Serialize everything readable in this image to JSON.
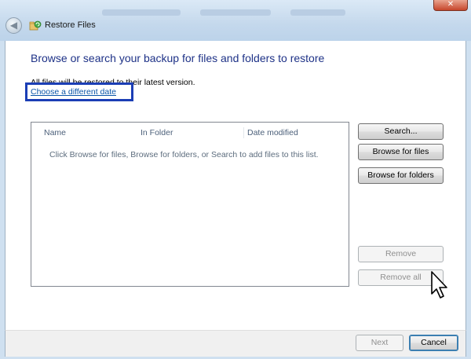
{
  "window": {
    "title": "Restore Files",
    "close_label": "✕",
    "back_label": "◀"
  },
  "page": {
    "heading": "Browse or search your backup for files and folders to restore",
    "info_text": "All files will be restored to their latest version.",
    "date_link": "Choose a different date"
  },
  "file_list": {
    "columns": [
      "Name",
      "In Folder",
      "Date modified"
    ],
    "empty_message": "Click Browse for files, Browse for folders, or Search to add files to this list."
  },
  "actions": {
    "search": "Search...",
    "browse_files": "Browse for files",
    "browse_folders": "Browse for folders",
    "remove": "Remove",
    "remove_all": "Remove all"
  },
  "footer": {
    "next": "Next",
    "cancel": "Cancel"
  },
  "icons": {
    "back": "back-arrow-icon",
    "app": "restore-files-icon",
    "close": "close-icon",
    "cursor": "mouse-pointer-icon"
  },
  "colors": {
    "heading": "#1e3287",
    "link": "#0b56a8",
    "highlight": "#1b3eb5"
  }
}
